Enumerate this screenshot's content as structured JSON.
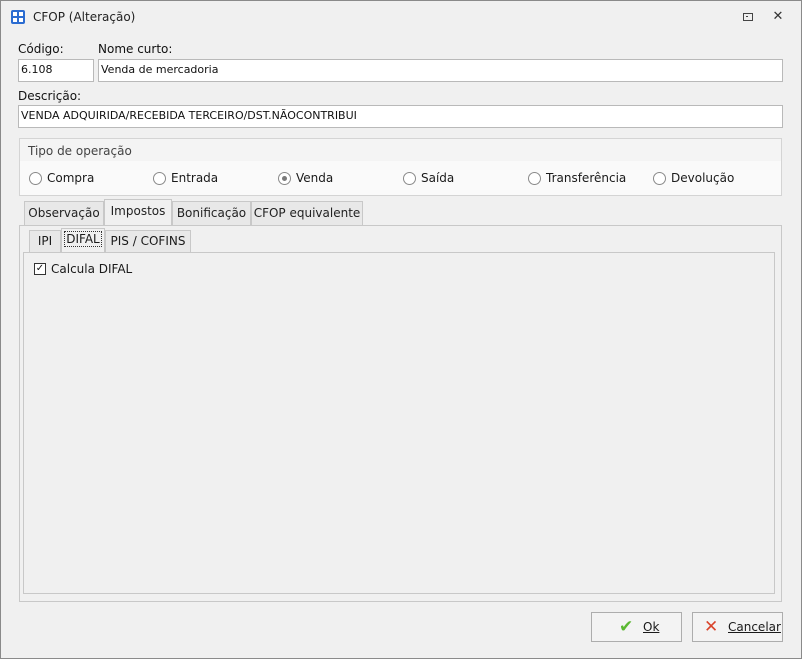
{
  "window": {
    "title": "CFOP (Alteração)"
  },
  "form": {
    "codigo_label": "Código:",
    "codigo_value": "6.108",
    "nome_curto_label": "Nome curto:",
    "nome_curto_value": "Venda de mercadoria",
    "descricao_label": "Descrição:",
    "descricao_value": "VENDA ADQUIRIDA/RECEBIDA TERCEIRO/DST.NÃOCONTRIBUI"
  },
  "tipo_operacao": {
    "title": "Tipo de operação",
    "options": [
      "Compra",
      "Entrada",
      "Venda",
      "Saída",
      "Transferência",
      "Devolução"
    ],
    "selected": "Venda"
  },
  "tabs": [
    "Observação",
    "Impostos",
    "Bonificação",
    "CFOP equivalente"
  ],
  "active_tab": "Impostos",
  "subtabs": [
    "IPI",
    "DIFAL",
    "PIS / COFINS"
  ],
  "active_subtab": "DIFAL",
  "difal": {
    "checkbox_label": "Calcula DIFAL",
    "checked": true
  },
  "buttons": {
    "ok": "Ok",
    "cancel": "Cancelar"
  },
  "colors": {
    "ok_icon": "#5bb832",
    "cancel_icon": "#d9442b",
    "app_icon": "#2b6cd1"
  }
}
